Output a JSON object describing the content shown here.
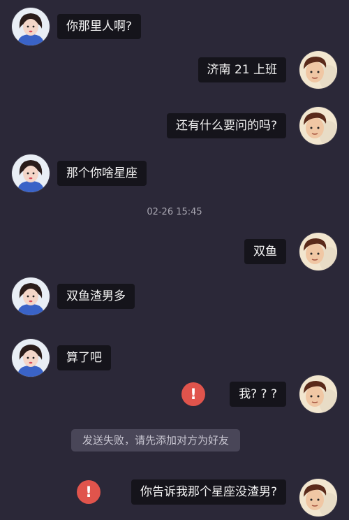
{
  "messages": [
    {
      "side": "left",
      "text": "你那里人啊?"
    },
    {
      "side": "right",
      "text": "济南 21 上班"
    },
    {
      "side": "right",
      "text": "还有什么要问的吗?"
    },
    {
      "side": "left",
      "text": "那个你啥星座"
    },
    {
      "side": "right",
      "text": "双鱼"
    },
    {
      "side": "left",
      "text": "双鱼渣男多"
    },
    {
      "side": "left",
      "text": "算了吧"
    },
    {
      "side": "right",
      "text": "我? ? ?",
      "failed": true
    },
    {
      "side": "right",
      "text": "你告诉我那个星座没渣男?",
      "failed": true
    }
  ],
  "timestamp": "02-26 15:45",
  "system_notice": "发送失败，请先添加对方为好友",
  "failed_icon_glyph": "!",
  "colors": {
    "background": "#2b2838",
    "bubble": "#15141b",
    "bubble_text": "#f2f2f2",
    "failed_icon": "#e0544c",
    "notice_bg": "#494658",
    "notice_text": "#c8c6d1"
  }
}
